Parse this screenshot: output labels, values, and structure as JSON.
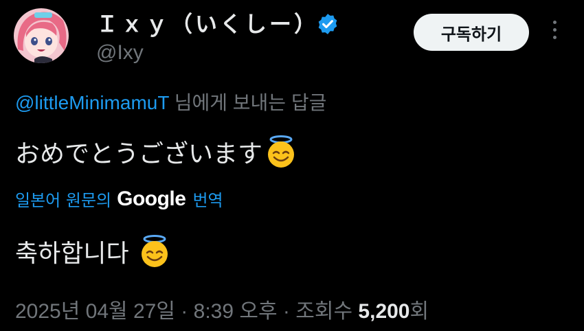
{
  "author": {
    "display_name": "Ｉｘｙ（いくしー）",
    "handle": "@Ixy",
    "verified_icon": "verified-badge-icon",
    "avatar": "anime-girl-avatar"
  },
  "subscribe_label": "구독하기",
  "more_icon": "more-vertical-icon",
  "reply": {
    "mention": "@littleMinimamuT",
    "suffix": " 님에게 보내는 답글"
  },
  "tweet_text": "おめでとうございます",
  "translation": {
    "prefix": "일본어 원문의",
    "provider": "Google",
    "suffix": "번역",
    "text": "축하합니다"
  },
  "meta": {
    "date": "2025년 04월 27일",
    "time": "8:39 오후",
    "views_label": "조회수",
    "views_count": "5,200",
    "views_suffix": "회",
    "separator": "·"
  },
  "emoji": "smiling-face-with-halo-icon",
  "colors": {
    "accent": "#1d9bf0",
    "secondary": "#71767b",
    "text": "#e7e9ea"
  }
}
